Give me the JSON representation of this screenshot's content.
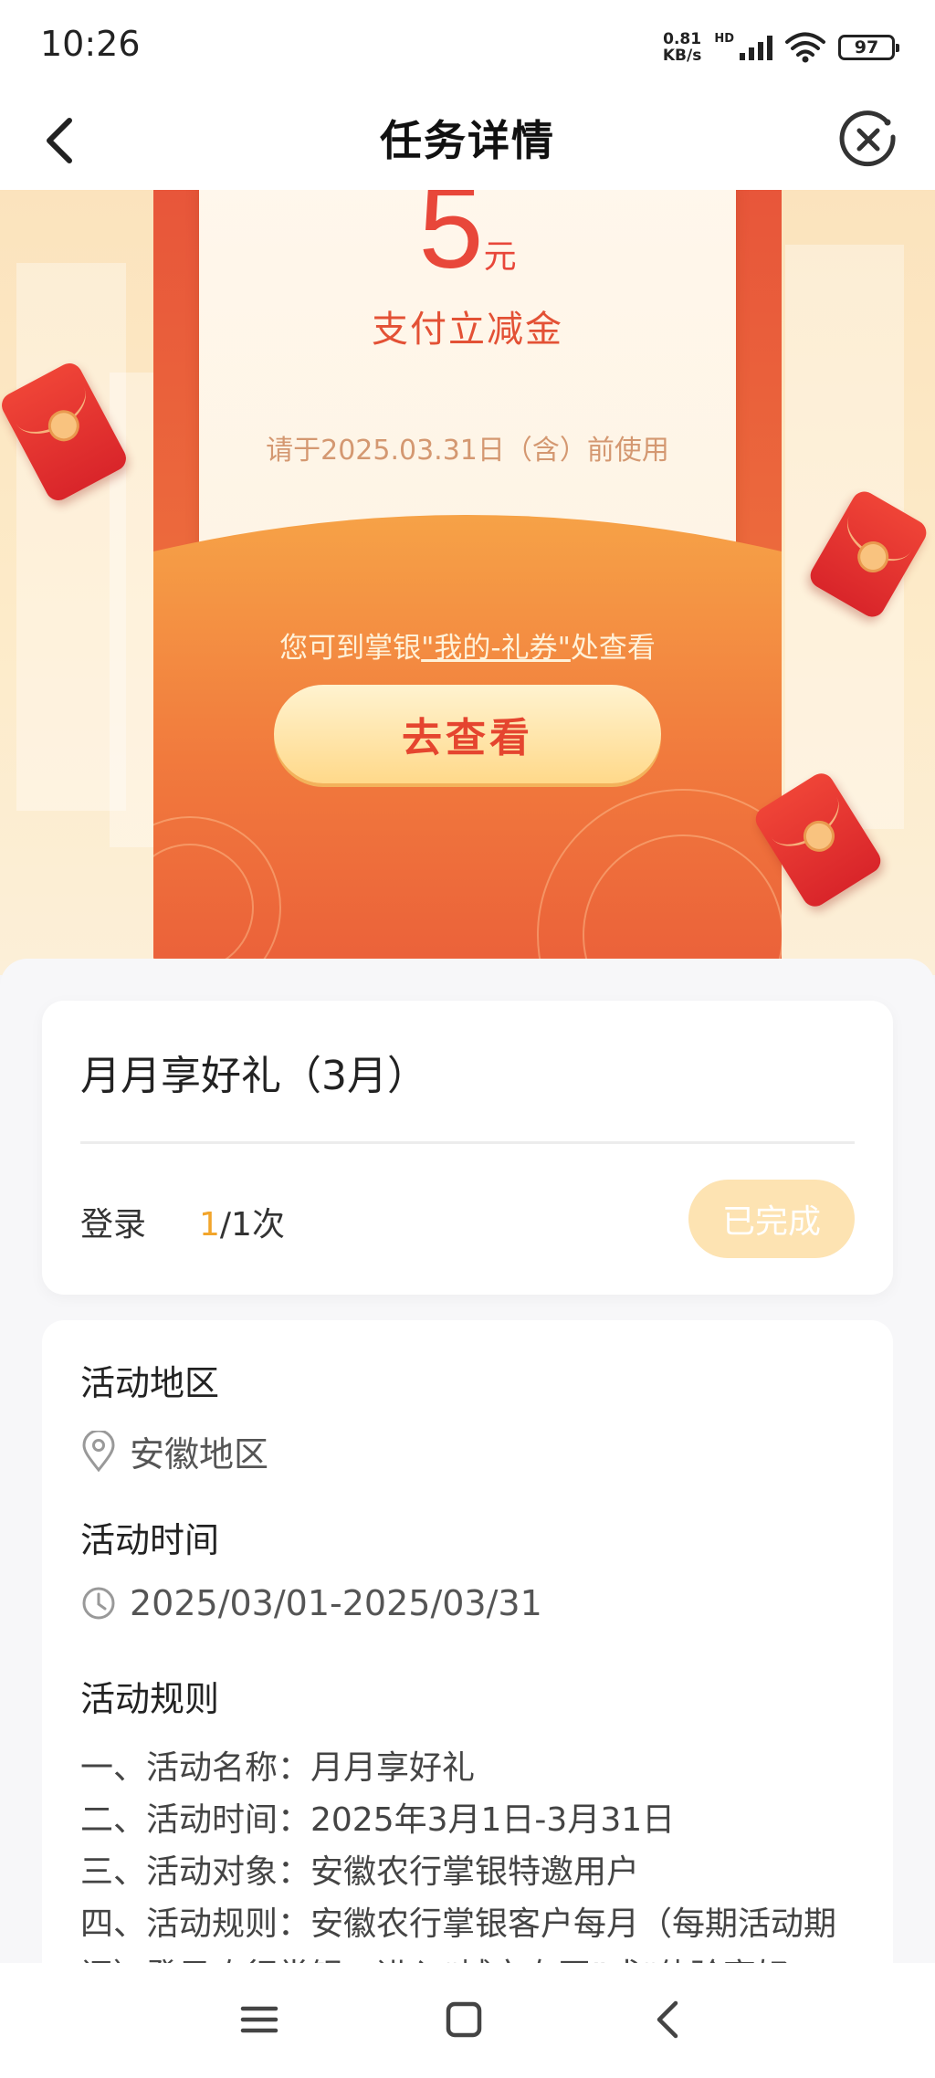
{
  "status_bar": {
    "time": "10:26",
    "net_speed_value": "0.81",
    "net_speed_unit": "KB/s",
    "hd": "HD",
    "battery": "97"
  },
  "nav": {
    "title": "任务详情",
    "back_icon": "chevron-left-icon",
    "close_icon": "close-circle-icon"
  },
  "coupon": {
    "amount": "5",
    "unit": "元",
    "name": "支付立减金",
    "expire_text": "请于2025.03.31日（含）前使用",
    "hint_prefix": "您可到掌银",
    "hint_link": "\"我的-礼券\"",
    "hint_suffix": "处查看",
    "view_button": "去查看"
  },
  "task": {
    "title": "月月享好礼（3月）",
    "label": "登录",
    "progress_current": "1",
    "progress_rest": "/1次",
    "status_button": "已完成"
  },
  "activity": {
    "region_title": "活动地区",
    "region_value": "安徽地区",
    "time_title": "活动时间",
    "time_value": "2025/03/01-2025/03/31",
    "rules_title": "活动规则",
    "rules": [
      "一、活动名称：月月享好礼",
      "二、活动时间：2025年3月1日-3月31日",
      "三、活动对象：安徽农行掌银特邀用户",
      "四、活动规则：安徽农行掌银客户每月（每期活动期间）登录农行掌银，进入“城市专区”或“体验享好"
    ]
  },
  "colors": {
    "accent_red": "#e8473a",
    "banner_bg": "#fbe3bd",
    "done_button": "#fde3b2",
    "progress_highlight": "#f2a52b"
  }
}
